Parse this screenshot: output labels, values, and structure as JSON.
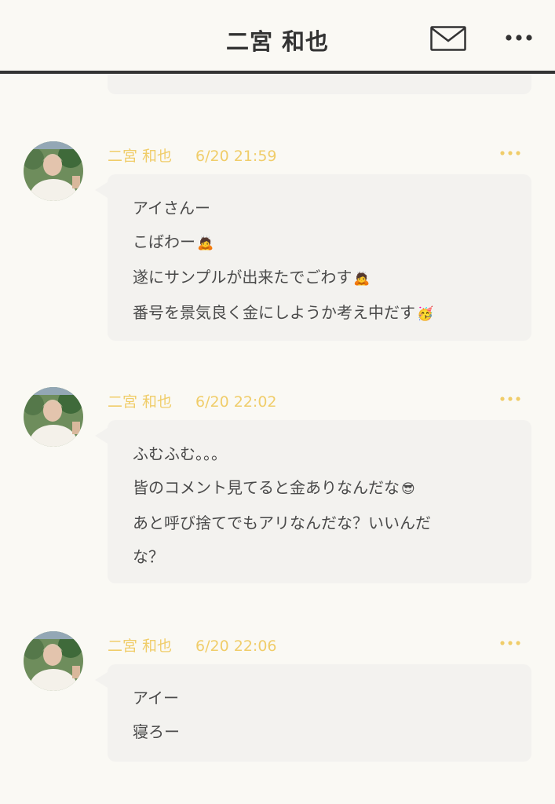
{
  "header": {
    "title": "二宮 和也",
    "mail_icon": "envelope-icon",
    "more_icon": "ellipsis-icon"
  },
  "colors": {
    "background": "#faf9f4",
    "bubble": "#f3f2ef",
    "meta_text": "#f0cd6a",
    "body_text": "#4a4a4a",
    "header_border": "#333333"
  },
  "messages": [
    {
      "sender": "二宮 和也",
      "time": "6/20 21:59",
      "lines": [
        {
          "text": "アイさんー",
          "emoji": ""
        },
        {
          "text": "こばわー",
          "emoji": "🙇"
        },
        {
          "text": "遂にサンプルが出来たでごわす",
          "emoji": "🙇"
        },
        {
          "text": "番号を景気良く金にしようか考え中だす",
          "emoji": "🥳"
        }
      ]
    },
    {
      "sender": "二宮 和也",
      "time": "6/20 22:02",
      "lines": [
        {
          "text": "ふむふむ。。。",
          "emoji": ""
        },
        {
          "text": "皆のコメント見てると金ありなんだな",
          "emoji": "😎"
        },
        {
          "text": "あと呼び捨てでもアリなんだな？いいんだ",
          "emoji": ""
        },
        {
          "text": "な？",
          "emoji": ""
        }
      ]
    },
    {
      "sender": "二宮 和也",
      "time": "6/20 22:06",
      "lines": [
        {
          "text": "アイー",
          "emoji": ""
        },
        {
          "text": "寝ろー",
          "emoji": ""
        }
      ]
    }
  ]
}
